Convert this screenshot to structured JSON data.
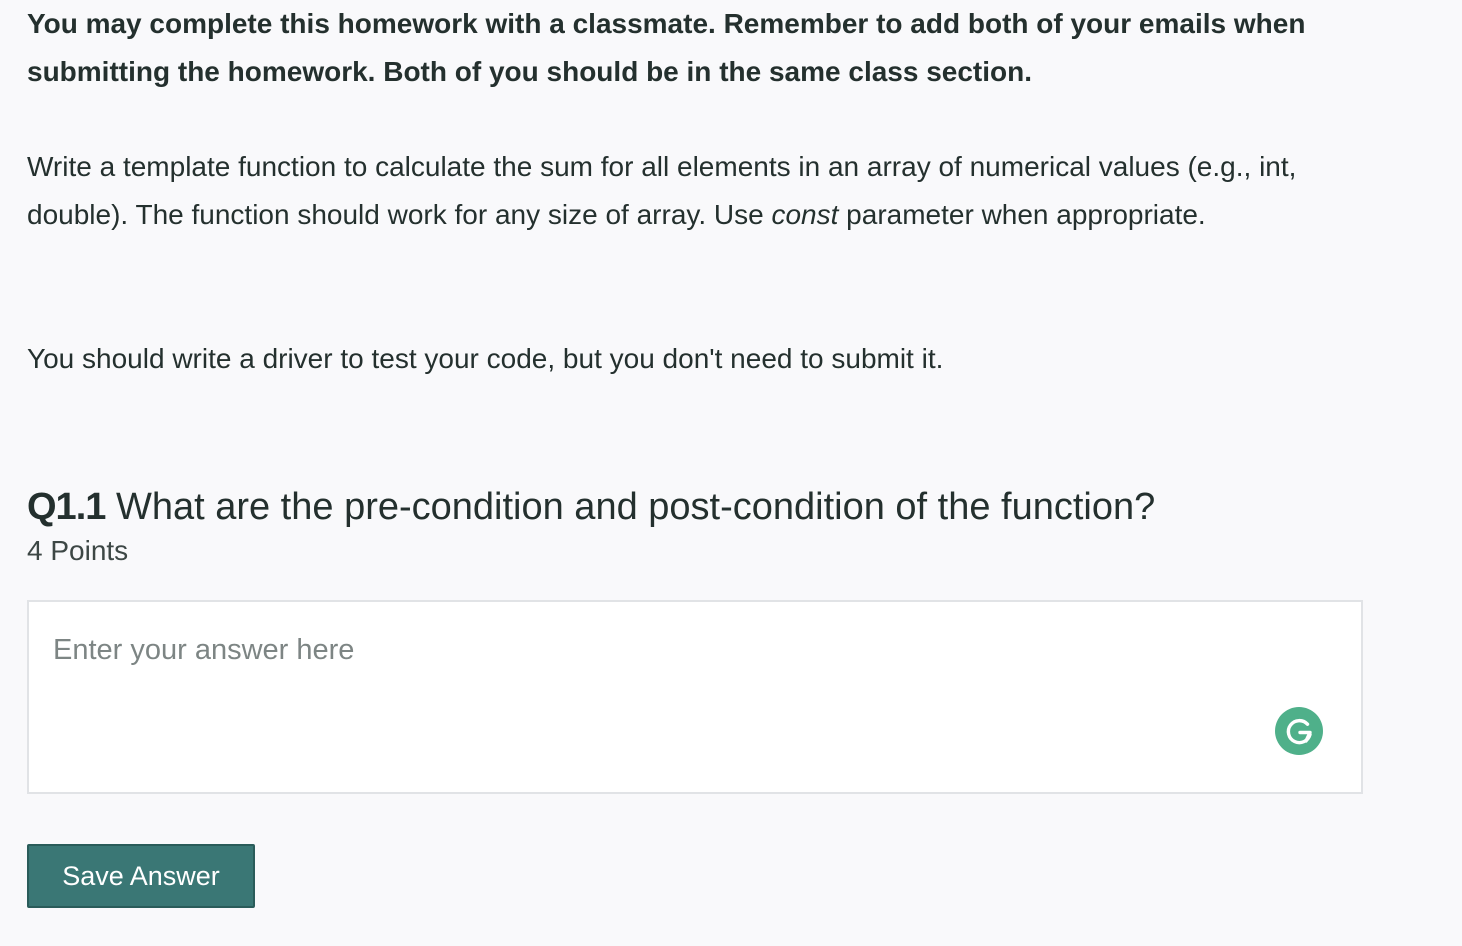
{
  "intro": {
    "bold_text": "You may complete this homework with a classmate.  Remember to add both of your emails when submitting the homework.  Both of you should be in the same class section."
  },
  "instructions": {
    "para1_before": "Write a template function to calculate the sum for all elements in an array of numerical values (e.g., int, double).  The function should work for any size of array. Use ",
    "para1_em": "const",
    "para1_after": " parameter when appropriate.",
    "para2": "You should write a driver to test your code, but you don't need to submit it."
  },
  "question": {
    "number": "Q1.1",
    "title": "What are the pre-condition and post-condition of the function?",
    "points": "4 Points"
  },
  "answer": {
    "value": "",
    "placeholder": "Enter your answer here"
  },
  "grammarly": {
    "icon": "grammarly-icon",
    "color": "#4fb08a"
  },
  "actions": {
    "save_label": "Save Answer"
  },
  "colors": {
    "background": "#f9f9fb",
    "text": "#24302e",
    "button": "#3a7775"
  }
}
